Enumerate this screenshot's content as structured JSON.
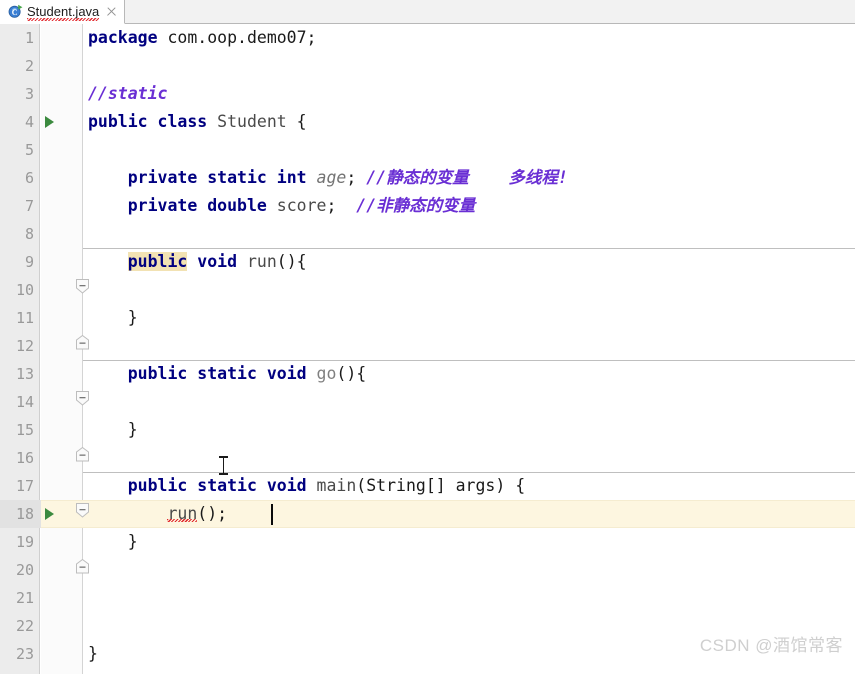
{
  "window": {
    "app": "IntelliJ IDEA Editor"
  },
  "tabbar": {
    "tabs": [
      {
        "label": "Student.java",
        "icon": "java-class-with-main-icon",
        "close_icon": "close-icon",
        "active": true,
        "has_error": true
      }
    ]
  },
  "editor": {
    "font_size_px": 16.5,
    "line_height_px": 28,
    "gutter": {
      "first_line": 1,
      "last_line": 23,
      "run_marker_lines": [
        4,
        17
      ],
      "fold_marker_lines": [
        9,
        11,
        13,
        15,
        17,
        19
      ]
    },
    "caret": {
      "line": 18,
      "column_after": "run();"
    },
    "current_line": 18,
    "method_separator_lines": [
      9,
      13,
      17
    ],
    "colors": {
      "keyword": "#000080",
      "comment": "#6a2fd4",
      "identifier": "#4a4a4a",
      "static_field": "#737373",
      "unused_method": "#808080",
      "error_squiggle": "#e0262b",
      "current_line_bg": "#fdf6e0",
      "caret_highlight_bg": "#f2e2b3",
      "gutter_bg": "#ececec",
      "editor_bg": "#ffffff",
      "run_marker": "#3b8a3f"
    },
    "lines": [
      {
        "n": 1,
        "text": "package com.oop.demo07;"
      },
      {
        "n": 2,
        "text": ""
      },
      {
        "n": 3,
        "text": "//static"
      },
      {
        "n": 4,
        "text": "public class Student {"
      },
      {
        "n": 5,
        "text": ""
      },
      {
        "n": 6,
        "text": "    private static int age; //静态的变量    多线程!"
      },
      {
        "n": 7,
        "text": "    private double score;  //非静态的变量"
      },
      {
        "n": 8,
        "text": ""
      },
      {
        "n": 9,
        "text": "    public void run(){"
      },
      {
        "n": 10,
        "text": ""
      },
      {
        "n": 11,
        "text": "    }"
      },
      {
        "n": 12,
        "text": ""
      },
      {
        "n": 13,
        "text": "    public static void go(){"
      },
      {
        "n": 14,
        "text": ""
      },
      {
        "n": 15,
        "text": "    }"
      },
      {
        "n": 16,
        "text": ""
      },
      {
        "n": 17,
        "text": "    public static void main(String[] args) {"
      },
      {
        "n": 18,
        "text": "        run();"
      },
      {
        "n": 19,
        "text": "    }"
      },
      {
        "n": 20,
        "text": ""
      },
      {
        "n": 21,
        "text": ""
      },
      {
        "n": 22,
        "text": ""
      },
      {
        "n": 23,
        "text": "}"
      }
    ],
    "tokens": {
      "l1_kw": "package",
      "l1_pkg": " com.oop.demo07;",
      "l3_comment": "//static",
      "l4_kw1": "public",
      "l4_kw2": "class",
      "l4_name": "Student",
      "l4_brace": "{",
      "l6_kw1": "private",
      "l6_kw2": "static",
      "l6_kw3": "int",
      "l6_field": "age",
      "l6_semi": ";",
      "l6_comment": "//静态的变量",
      "l6_comment2": "多线程!",
      "l7_kw1": "private",
      "l7_kw2": "double",
      "l7_field": "score",
      "l7_semi": ";",
      "l7_comment": "//非静态的变量",
      "l9_kw1": "public",
      "l9_kw2": "void",
      "l9_name": "run",
      "l9_tail": "(){",
      "l11_brace": "}",
      "l13_kw1": "public",
      "l13_kw2": "static",
      "l13_kw3": "void",
      "l13_name": "go",
      "l13_tail": "(){",
      "l15_brace": "}",
      "l17_kw1": "public",
      "l17_kw2": "static",
      "l17_kw3": "void",
      "l17_name": "main",
      "l17_params": "(String[] args) {",
      "l18_call": "run",
      "l18_tail": "();",
      "l19_brace": "}",
      "l23_brace": "}"
    }
  },
  "watermark": {
    "text": "CSDN @酒馆常客"
  }
}
